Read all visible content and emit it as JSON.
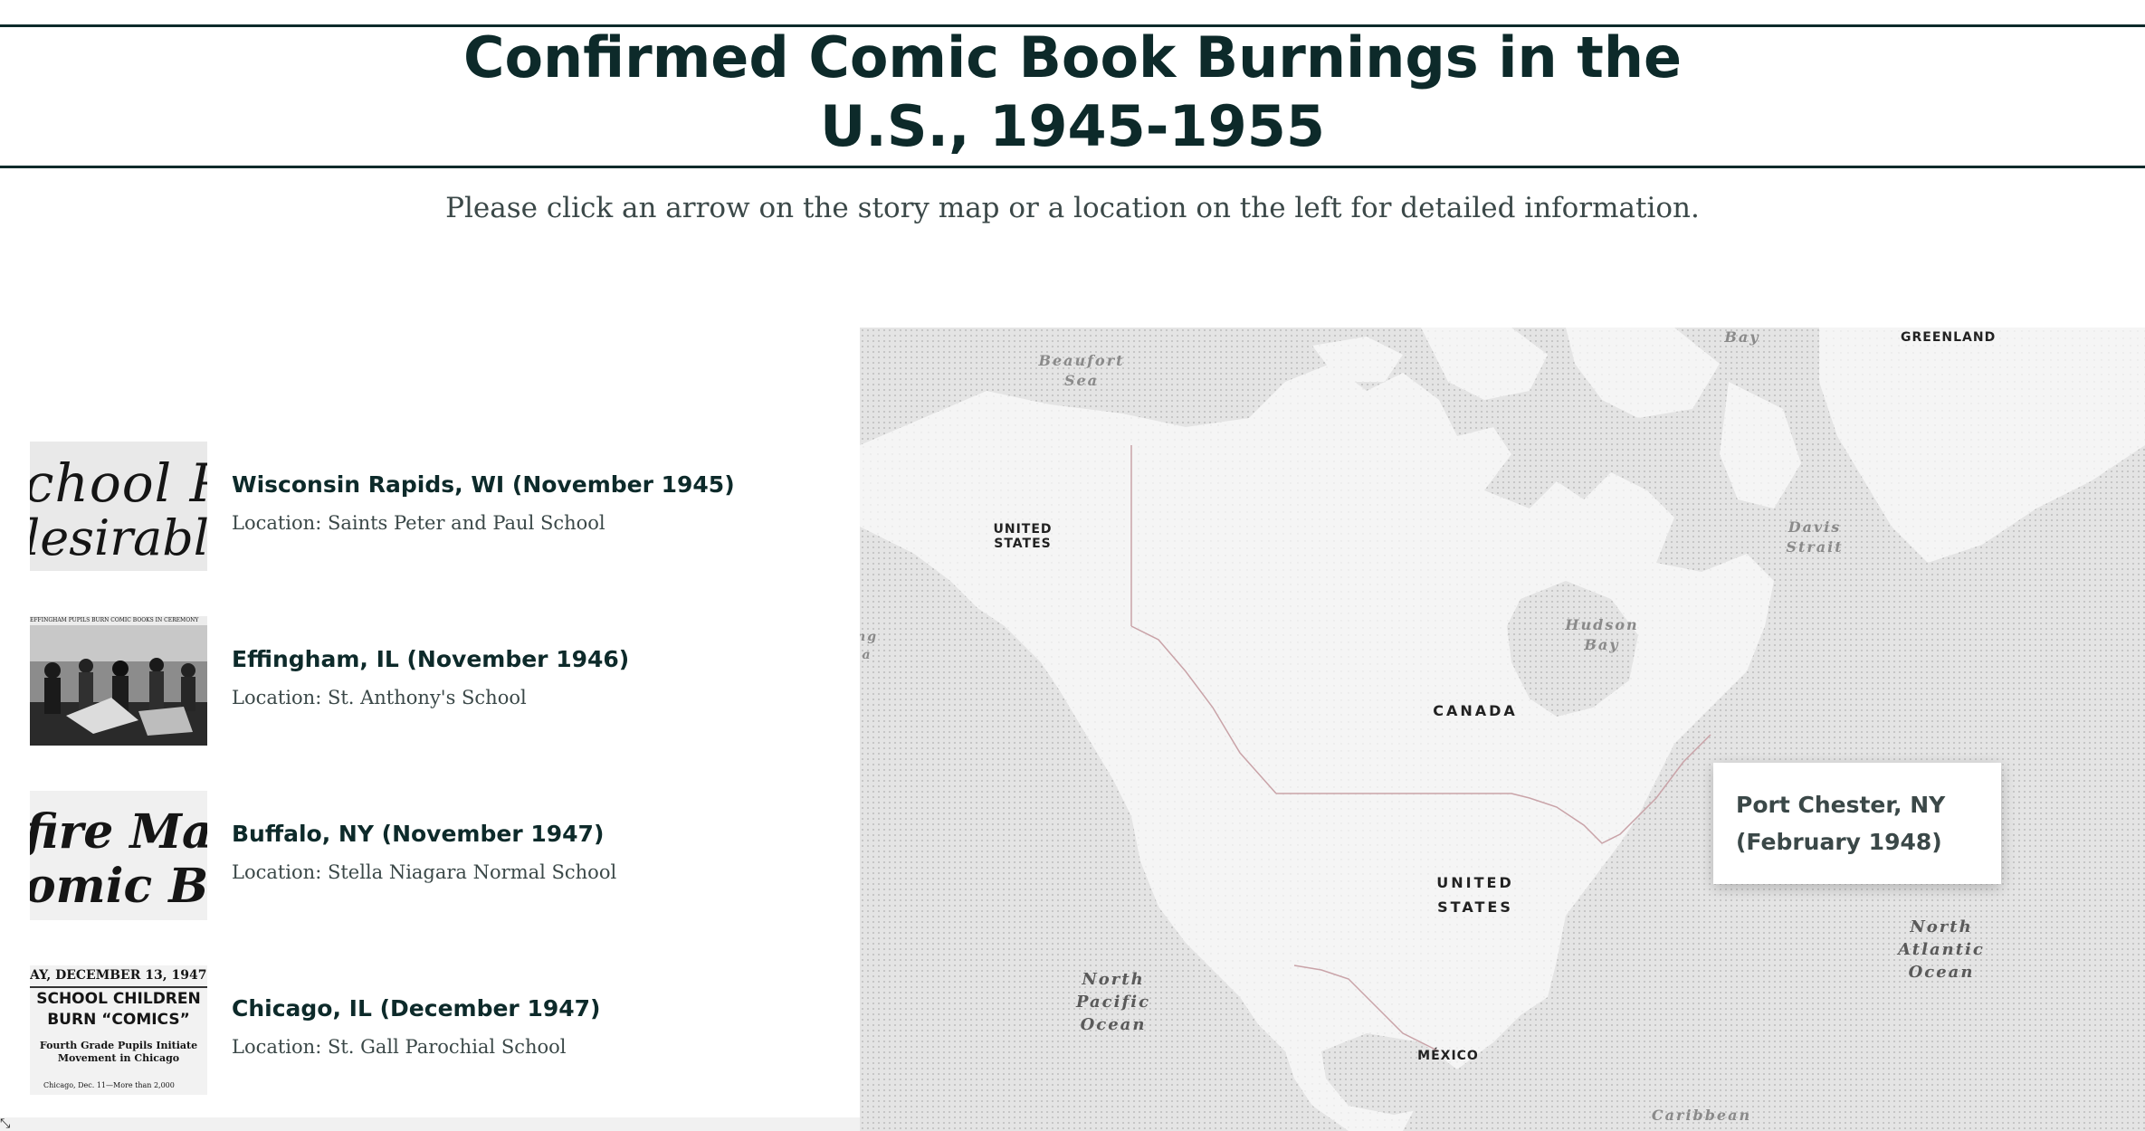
{
  "header": {
    "title_line1": "Confirmed Comic Book Burnings in the",
    "title_line2": "U.S., 1945-1955",
    "subtitle": "Please click an arrow on the story map or a location on the left for detailed information."
  },
  "locations": [
    {
      "title": "Wisconsin Rapids, WI (November 1945)",
      "location": "Location: Saints Peter and Paul School",
      "thumb_lines": [
        "chool Pu",
        "lesirable'"
      ]
    },
    {
      "title": "Effingham, IL (November 1946)",
      "location": "Location: St. Anthony's School",
      "thumb_lines": [
        "EFFINGHAM PUPILS BURN COMIC BOOKS IN CEREMONY"
      ]
    },
    {
      "title": "Buffalo, NY (November 1947)",
      "location": "Location: Stella Niagara Normal School",
      "thumb_lines": [
        "fire Mad",
        "omic Bo"
      ]
    },
    {
      "title": "Chicago, IL (December 1947)",
      "location": "Location: St. Gall Parochial School",
      "thumb_lines": [
        "AY, DECEMBER 13, 1947",
        "SCHOOL CHILDREN",
        "BURN “COMICS”",
        "Fourth Grade Pupils Initiate",
        "Movement in Chicago",
        "Chicago, Dec. 11—More than 2,000"
      ]
    }
  ],
  "map": {
    "labels": {
      "beaufort_sea": [
        "Beaufort",
        "Sea"
      ],
      "baffin_bay": "Bay",
      "greenland": "GREENLAND",
      "united_states_alaska": [
        "UNITED",
        "STATES"
      ],
      "davis_strait": [
        "Davis",
        "Strait"
      ],
      "hudson_bay": [
        "Hudson",
        "Bay"
      ],
      "canada": "CANADA",
      "united_states": [
        "UNITED",
        "STATES"
      ],
      "mexico": "MÉXICO",
      "north_pacific": [
        "North",
        "Pacific",
        "Ocean"
      ],
      "north_atlantic": [
        "North",
        "Atlantic",
        "Ocean"
      ],
      "caribbean": "Caribbean",
      "bering_fragment": [
        "ng",
        "a"
      ]
    },
    "popup": {
      "line1": "Port Chester, NY",
      "line2": "(February 1948)"
    },
    "colors": {
      "land": "#f4f4f4",
      "water": "#e3e3e3",
      "border": "#c9a3a8"
    }
  },
  "icons": {
    "resize": "resize-corner-icon"
  }
}
